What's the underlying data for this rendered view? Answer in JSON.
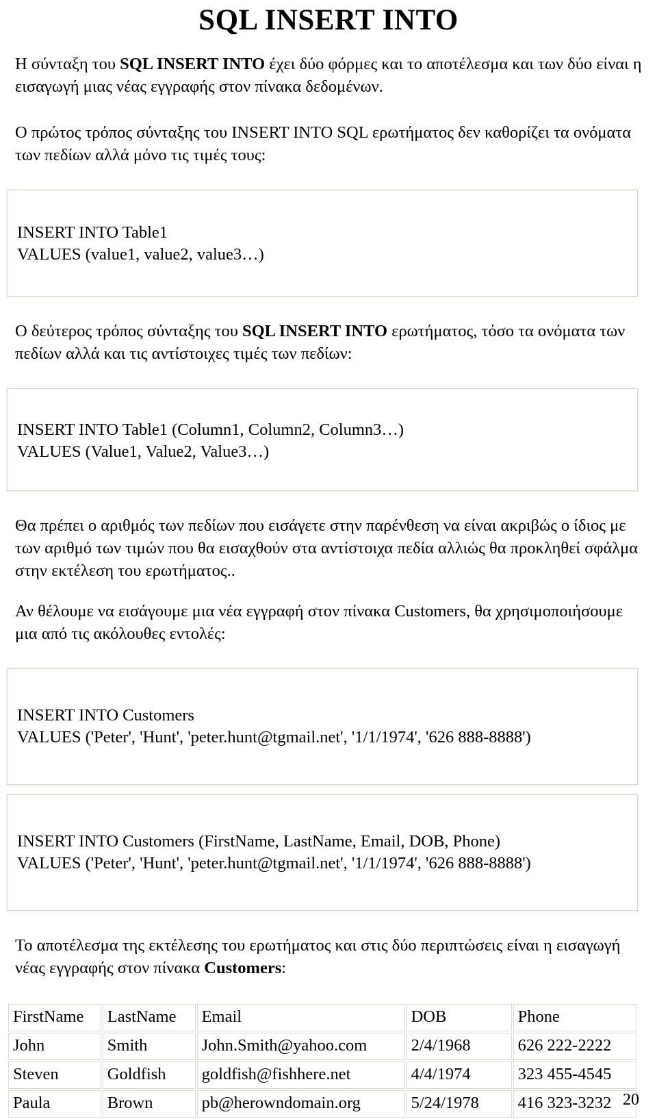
{
  "document": {
    "title": "SQL INSERT INTO",
    "page_number": "20"
  },
  "intro": {
    "line1_pre": "Η σύνταξη του ",
    "line1_bold": "SQL INSERT INTO",
    "line1_post": " έχει δύο φόρμες και το αποτέλεσμα και των δύο είναι η εισαγωγή μιας νέας εγγραφής στον πίνακα δεδομένων."
  },
  "section_first_form": {
    "paragraph": "Ο πρώτος τρόπος σύνταξης του INSERT INTO SQL ερωτήματος δεν καθορίζει τα ονόματα των πεδίων αλλά μόνο τις τιμές τους:",
    "code_line1": "INSERT INTO Table1",
    "code_line2": "VALUES (value1, value2, value3…)"
  },
  "section_second_form": {
    "paragraph_pre": "Ο δεύτερος τρόπος σύνταξης του ",
    "paragraph_bold": "SQL INSERT INTO",
    "paragraph_post": " ερωτήματος, τόσο τα ονόματα των πεδίων αλλά και τις αντίστοιχες τιμές των πεδίων:",
    "code_line1": "INSERT INTO Table1 (Column1, Column2, Column3…)",
    "code_line2": "VALUES (Value1, Value2, Value3…)"
  },
  "notes": {
    "warning": "Θα πρέπει ο αριθμός των πεδίων που εισάγετε στην παρένθεση να είναι ακριβώς ο ίδιος με των αριθμό των τιμών που θα εισαχθούν στα αντίστοιχα πεδία αλλιώς θα προκληθεί σφάλμα στην εκτέλεση του ερωτήματος..",
    "example_intro": "Αν θέλουμε να εισάγουμε μια νέα εγγραφή στον πίνακα Customers, θα χρησιμοποιήσουμε μια από τις ακόλουθες εντολές:"
  },
  "example_one": {
    "code_line1": "INSERT INTO Customers",
    "code_line2": "VALUES ('Peter', 'Hunt', 'peter.hunt@tgmail.net', '1/1/1974', '626 888-8888')"
  },
  "example_two": {
    "code_line1": "INSERT INTO Customers (FirstName, LastName, Email, DOB, Phone)",
    "code_line2": "VALUES ('Peter', 'Hunt', 'peter.hunt@tgmail.net', '1/1/1974', '626 888-8888')"
  },
  "result": {
    "paragraph_pre": "Το αποτέλεσμα της εκτέλεσης του ερωτήματος και στις δύο περιπτώσεις είναι η εισαγωγή νέας εγγραφής στον πίνακα ",
    "paragraph_bold": "Customers",
    "paragraph_post": ":"
  },
  "customers_table": {
    "headers": [
      "FirstName",
      "LastName",
      "Email",
      "DOB",
      "Phone"
    ],
    "rows": [
      [
        "John",
        "Smith",
        "John.Smith@yahoo.com",
        "2/4/1968",
        "626 222-2222"
      ],
      [
        "Steven",
        "Goldfish",
        "goldfish@fishhere.net",
        "4/4/1974",
        "323 455-4545"
      ],
      [
        "Paula",
        "Brown",
        "pb@herowndomain.org",
        "5/24/1978",
        "416 323-3232"
      ]
    ]
  }
}
